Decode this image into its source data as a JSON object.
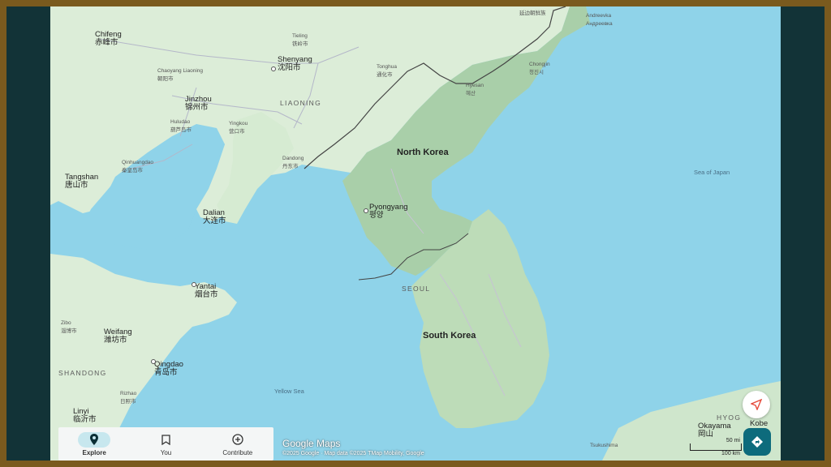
{
  "map": {
    "countries": [
      "North Korea",
      "South Korea"
    ],
    "regions": [
      "LIAONING",
      "SHANDONG",
      "SEOUL",
      "HYOG"
    ],
    "waters": [
      "Sea of Japan",
      "Yellow Sea"
    ],
    "cities": [
      {
        "name": "Chifeng",
        "local": "赤峰市"
      },
      {
        "name": "Shenyang",
        "local": "沈阳市"
      },
      {
        "name": "Tieling",
        "local": "铁岭市"
      },
      {
        "name": "Tonghua",
        "local": "通化市"
      },
      {
        "name": "Chaoyang Liaoning",
        "local": "朝阳市"
      },
      {
        "name": "Jinzhou",
        "local": "锦州市"
      },
      {
        "name": "Huludao",
        "local": "葫芦岛市"
      },
      {
        "name": "Yingkou",
        "local": "营口市"
      },
      {
        "name": "Qinhuangdao",
        "local": "秦皇岛市"
      },
      {
        "name": "Tangshan",
        "local": "唐山市"
      },
      {
        "name": "Dandong",
        "local": "丹东市"
      },
      {
        "name": "Dalian",
        "local": "大连市"
      },
      {
        "name": "Pyongyang",
        "local": "평양"
      },
      {
        "name": "Hyesan",
        "local": "혜산"
      },
      {
        "name": "Chongjin",
        "local": "청진시"
      },
      {
        "name": "Yantai",
        "local": "烟台市"
      },
      {
        "name": "Weifang",
        "local": "潍坊市"
      },
      {
        "name": "Qingdao",
        "local": "青岛市"
      },
      {
        "name": "Rizhao",
        "local": "日照市"
      },
      {
        "name": "Linyi",
        "local": "临沂市"
      },
      {
        "name": "Zibo",
        "local": "淄博市"
      },
      {
        "name": "Andreevka",
        "local": "Андреевка"
      },
      {
        "name": "Okayama",
        "local": "岡山"
      },
      {
        "name": "Kobe",
        "local": ""
      },
      {
        "name": "Tsukushima",
        "local": ""
      },
      {
        "name": "",
        "local": "延边朝鲜族"
      }
    ]
  },
  "nav": {
    "items": [
      {
        "label": "Explore",
        "icon": "map-pin-icon",
        "active": true
      },
      {
        "label": "You",
        "icon": "bookmark-icon",
        "active": false
      },
      {
        "label": "Contribute",
        "icon": "plus-circle-icon",
        "active": false
      }
    ]
  },
  "branding": {
    "logo": "Google Maps",
    "attribution": "©2025 Google · Map data ©2025 TMap Mobility, Google"
  },
  "scale": {
    "miles": "50 mi",
    "km": "100 km"
  },
  "colors": {
    "water": "#8fd3e9",
    "land": "#d9ecd9",
    "mountains": "#9fc9a2",
    "accent": "#0d6b7c"
  }
}
